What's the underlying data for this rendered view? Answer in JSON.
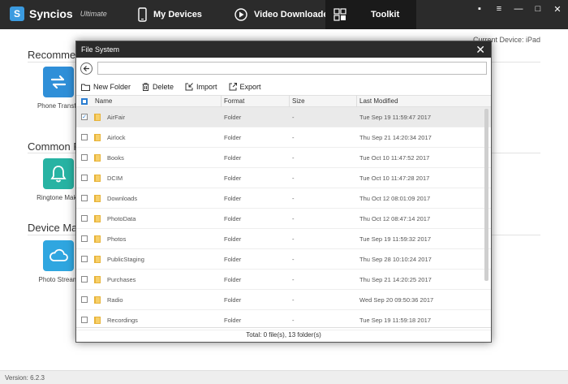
{
  "app": {
    "name": "Syncios",
    "edition": "Ultimate",
    "logo_letter": "S"
  },
  "nav": {
    "my_devices": "My Devices",
    "video_downloader": "Video Downloader",
    "toolkit": "Toolkit"
  },
  "window_controls": {
    "menu": "▪",
    "dropdown": "≡",
    "minimize": "—",
    "maximize": "□",
    "close": "✕"
  },
  "current_device": "Current Device: iPad",
  "sections": {
    "recommended": "Recommen",
    "common": "Common F",
    "device_manager": "Device Ma"
  },
  "tools": {
    "phone_transfer": "Phone Transfe",
    "ringtone_maker": "Ringtone Make",
    "photo_stream": "Photo Stream"
  },
  "dialog": {
    "title": "File System",
    "close": "✕",
    "path_value": "",
    "toolbar": {
      "new_folder": "New Folder",
      "delete": "Delete",
      "import": "Import",
      "export": "Export"
    },
    "columns": {
      "name": "Name",
      "format": "Format",
      "size": "Size",
      "last_modified": "Last Modified"
    },
    "rows": [
      {
        "name": "AirFair",
        "format": "Folder",
        "size": "-",
        "date": "Tue Sep 19 11:59:47 2017",
        "checked": true
      },
      {
        "name": "Airlock",
        "format": "Folder",
        "size": "-",
        "date": "Thu Sep 21 14:20:34 2017",
        "checked": false
      },
      {
        "name": "Books",
        "format": "Folder",
        "size": "-",
        "date": "Tue Oct 10 11:47:52 2017",
        "checked": false
      },
      {
        "name": "DCIM",
        "format": "Folder",
        "size": "-",
        "date": "Tue Oct 10 11:47:28 2017",
        "checked": false
      },
      {
        "name": "Downloads",
        "format": "Folder",
        "size": "-",
        "date": "Thu Oct 12 08:01:09 2017",
        "checked": false
      },
      {
        "name": "PhotoData",
        "format": "Folder",
        "size": "-",
        "date": "Thu Oct 12 08:47:14 2017",
        "checked": false
      },
      {
        "name": "Photos",
        "format": "Folder",
        "size": "-",
        "date": "Tue Sep 19 11:59:32 2017",
        "checked": false
      },
      {
        "name": "PublicStaging",
        "format": "Folder",
        "size": "-",
        "date": "Thu Sep 28 10:10:24 2017",
        "checked": false
      },
      {
        "name": "Purchases",
        "format": "Folder",
        "size": "-",
        "date": "Thu Sep 21 14:20:25 2017",
        "checked": false
      },
      {
        "name": "Radio",
        "format": "Folder",
        "size": "-",
        "date": "Wed Sep 20 09:50:36 2017",
        "checked": false
      },
      {
        "name": "Recordings",
        "format": "Folder",
        "size": "-",
        "date": "Tue Sep 19 11:59:18 2017",
        "checked": false
      }
    ],
    "footer": "Total: 0 file(s), 13 folder(s)"
  },
  "status": {
    "version": "Version: 6.2.3"
  },
  "colors": {
    "accent": "#2a7dd1",
    "topbar": "#2b2b2b",
    "tool_blue": "#2f8fd8",
    "tool_teal": "#27b3a3",
    "tool_sky": "#2fa6e0"
  }
}
